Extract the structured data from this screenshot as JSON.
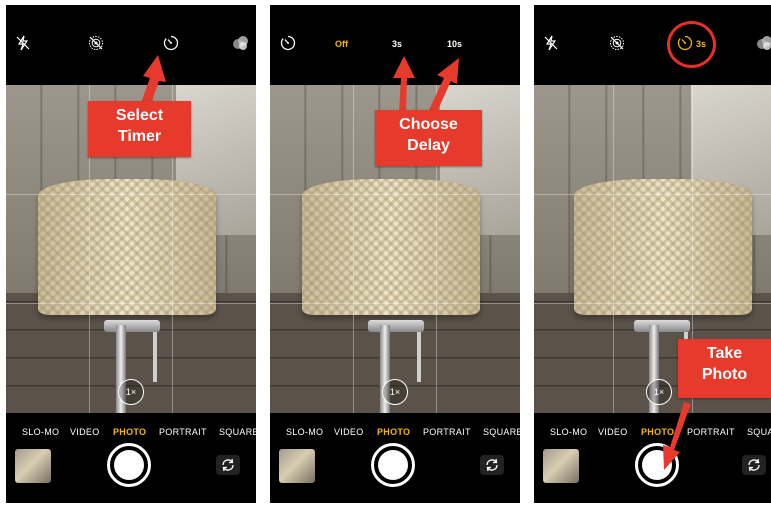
{
  "colors": {
    "accent_yellow": "#f5b800",
    "callout_red": "#e53a2c"
  },
  "panels": [
    {
      "callout": {
        "line1": "Select",
        "line2": "Timer"
      },
      "zoom": "1×",
      "modes": [
        "SLO-MO",
        "VIDEO",
        "PHOTO",
        "PORTRAIT",
        "SQUARE"
      ],
      "active_mode": "PHOTO"
    },
    {
      "timer_options": {
        "off": "Off",
        "three": "3s",
        "ten": "10s"
      },
      "callout": {
        "line1": "Choose",
        "line2": "Delay"
      },
      "zoom": "1×",
      "modes": [
        "SLO-MO",
        "VIDEO",
        "PHOTO",
        "PORTRAIT",
        "SQUARE"
      ],
      "active_mode": "PHOTO"
    },
    {
      "timer_value": "3s",
      "callout": {
        "line1": "Take",
        "line2": "Photo"
      },
      "zoom": "1×",
      "modes": [
        "SLO-MO",
        "VIDEO",
        "PHOTO",
        "PORTRAIT",
        "SQUARE"
      ],
      "active_mode": "PHOTO"
    }
  ]
}
